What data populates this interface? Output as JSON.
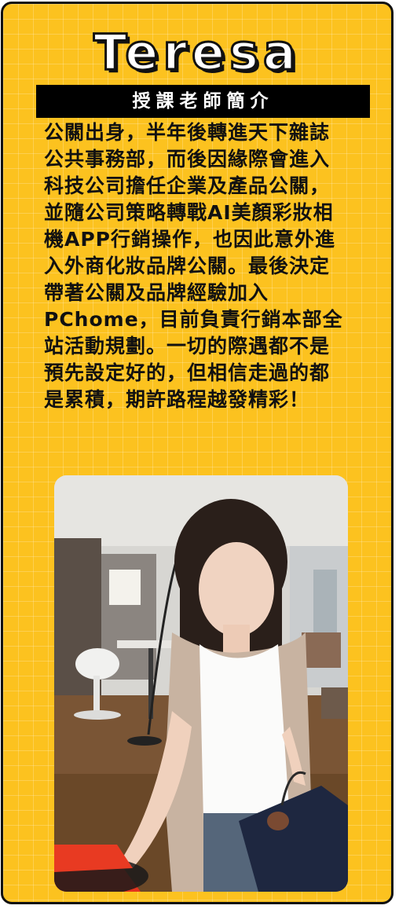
{
  "profile": {
    "name": "Teresa",
    "section_title": "授課老師簡介",
    "bio_lines": [
      "公關出身，半年後轉進天下雜誌",
      "公共事務部，而後因緣際會進入",
      "科技公司擔任企業及產品公關，",
      "並隨公司策略轉戰AI美顏彩妝相",
      "機APP行銷操作，也因此意外進",
      "入外商化妝品牌公關。最後決定",
      "帶著公關及品牌經驗加入",
      "PChome，目前負責行銷本部全",
      "站活動規劃。一切的際遇都不是",
      "預先設定好的，但相信走過的都",
      "是累積，期許路程越發精彩！"
    ]
  },
  "colors": {
    "card_background": "#fcc21f",
    "title_bar": "#000000",
    "border": "#111111"
  }
}
